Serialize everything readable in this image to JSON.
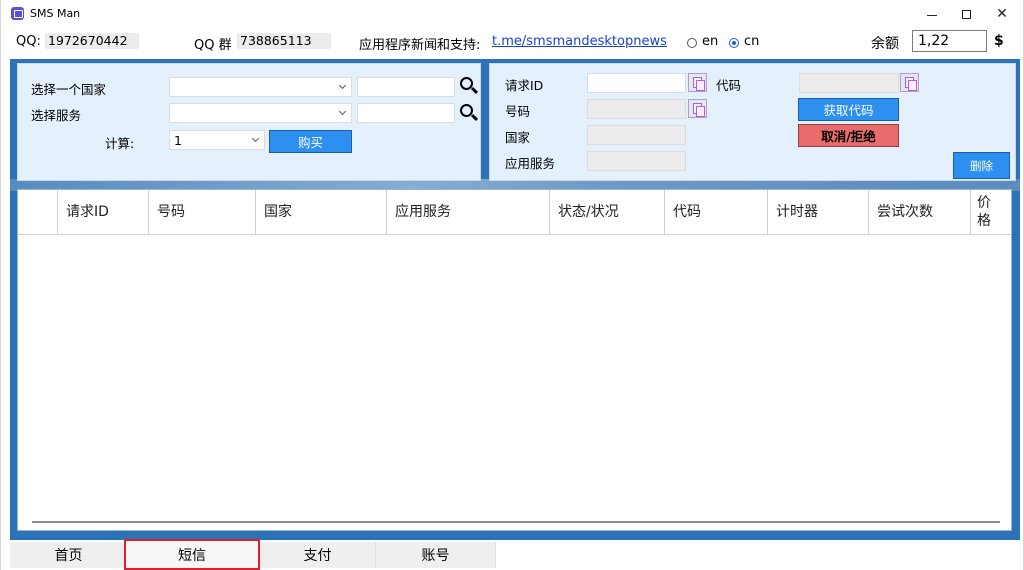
{
  "window": {
    "title": "SMS Man"
  },
  "info": {
    "qq_label": "QQ:",
    "qq_value": "1972670442",
    "qq_group_label": "QQ 群",
    "qq_group_value": "738865113",
    "news_label": "应用程序新闻和支持:",
    "news_link": "t.me/smsmandesktopnews",
    "lang_en": "en",
    "lang_cn": "cn",
    "lang_selected": "cn",
    "balance_label": "余额",
    "balance_value": "1,22",
    "currency": "$"
  },
  "buy_panel": {
    "country_label": "选择一个国家",
    "service_label": "选择服务",
    "count_label": "计算:",
    "count_value": "1",
    "buy_button": "购买"
  },
  "request_panel": {
    "request_id_label": "请求ID",
    "code_label": "代码",
    "number_label": "号码",
    "country_label": "国家",
    "service_label": "应用服务",
    "get_code_button": "获取代码",
    "cancel_button": "取消/拒绝",
    "delete_button": "删除"
  },
  "table": {
    "columns": [
      "",
      "请求ID",
      "号码",
      "国家",
      "应用服务",
      "状态/状况",
      "代码",
      "计时器",
      "尝试次数",
      "价格"
    ],
    "rows": []
  },
  "tabs": [
    {
      "label": "首页",
      "active": false
    },
    {
      "label": "短信",
      "active": true
    },
    {
      "label": "支付",
      "active": false
    },
    {
      "label": "账号",
      "active": false
    }
  ],
  "colors": {
    "accent_blue": "#2d8ff0",
    "cancel_red": "#e86c6c",
    "panel_bg": "#e4f0fb",
    "frame_blue": "#2b72b7",
    "link": "#1a3fd6",
    "active_tab_border": "#e01d2d"
  }
}
